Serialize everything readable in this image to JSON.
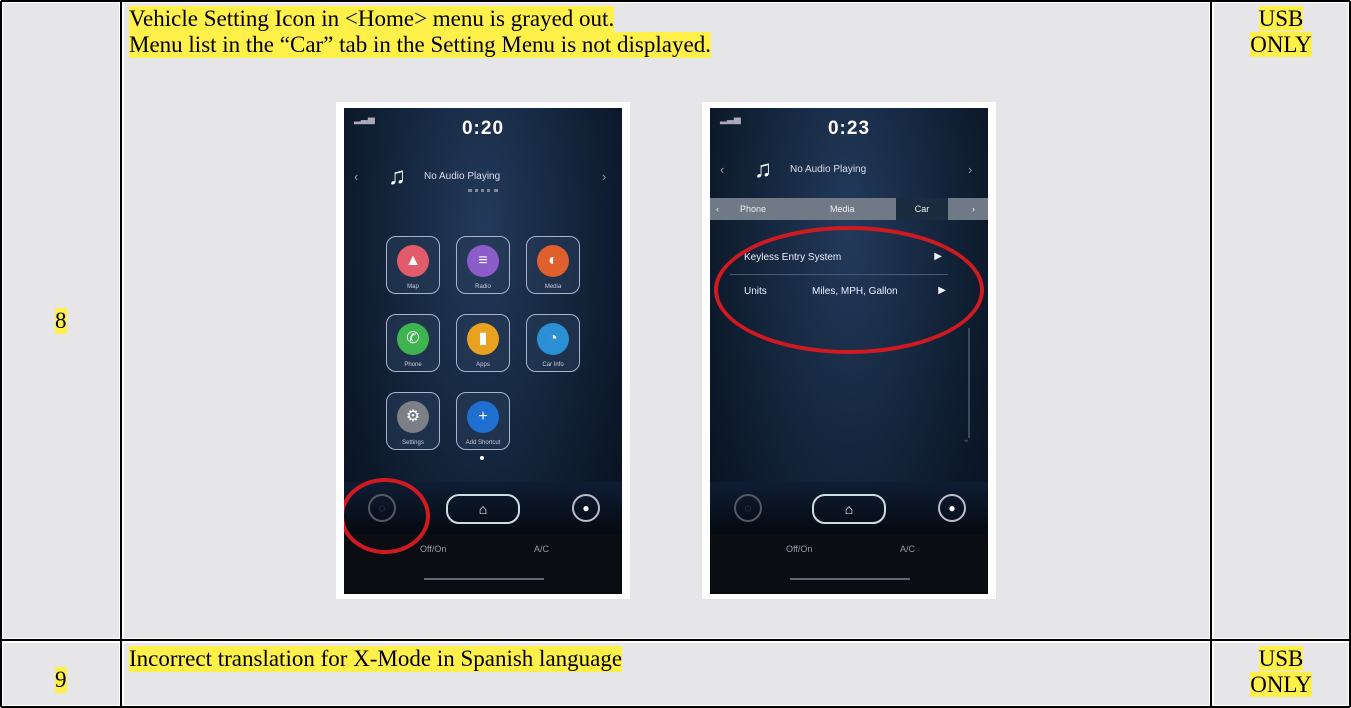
{
  "rows": [
    {
      "number": "8",
      "description_line1": "Vehicle Setting Icon in <Home> menu is grayed out.",
      "description_line2": "Menu list in the “Car” tab in the Setting Menu is not displayed.",
      "tag_line1": "USB",
      "tag_line2": "ONLY"
    },
    {
      "number": "9",
      "description_line1": "Incorrect translation for X-Mode in Spanish language",
      "tag_line1": "USB",
      "tag_line2": "ONLY"
    }
  ],
  "screenshot_home": {
    "clock": "0:20",
    "audio_text": "No Audio Playing",
    "apps": [
      "Map",
      "Radio",
      "Media",
      "Phone",
      "Apps",
      "Car Info",
      "Settings",
      "Add Shortcut"
    ],
    "climate": "Off/On",
    "annotation": "Vehicle setting icon grayed out (circled in red)"
  },
  "screenshot_car_tab": {
    "clock": "0:23",
    "audio_text": "No Audio Playing",
    "tabs": [
      "Phone",
      "Media",
      "Car"
    ],
    "menu_items": [
      {
        "label": "Keyless Entry System",
        "value": ""
      },
      {
        "label": "Units",
        "value": "Miles, MPH, Gallon"
      }
    ],
    "climate": "Off/On"
  },
  "colors": {
    "highlight": "#fff04a",
    "cell_bg": "#e6e6e8",
    "border": "#000000",
    "red_circle": "#d01a20"
  }
}
